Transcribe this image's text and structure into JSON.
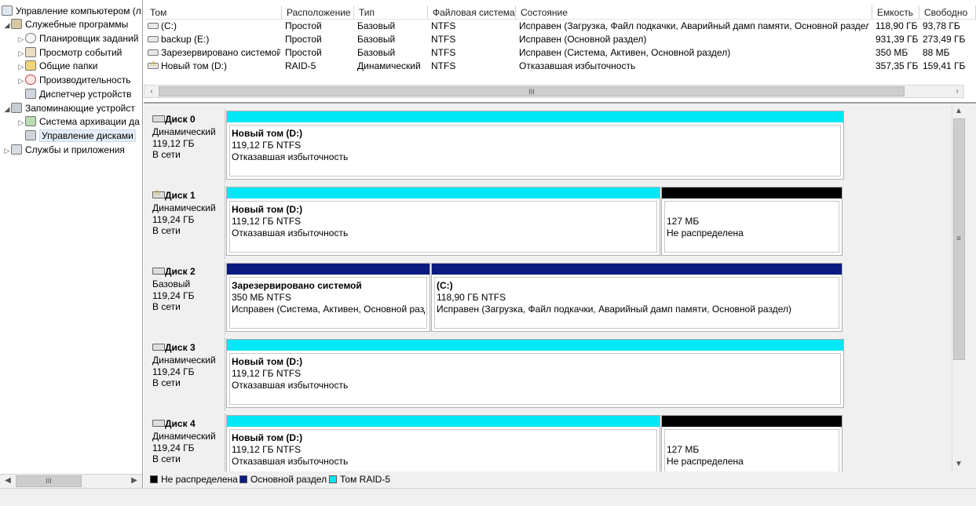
{
  "tree": {
    "root": "Управление компьютером (л",
    "items": [
      {
        "label": "Служебные программы",
        "icon": "tools-icon"
      },
      {
        "label": "Планировщик заданий",
        "icon": "clock-icon"
      },
      {
        "label": "Просмотр событий",
        "icon": "event-viewer-icon"
      },
      {
        "label": "Общие папки",
        "icon": "shared-folder-icon"
      },
      {
        "label": "Производительность",
        "icon": "performance-icon"
      },
      {
        "label": "Диспетчер устройств",
        "icon": "device-manager-icon"
      },
      {
        "label": "Запоминающие устройст",
        "icon": "storage-icon"
      },
      {
        "label": "Система архивации да",
        "icon": "backup-icon"
      },
      {
        "label": "Управление дисками",
        "icon": "disk-management-icon"
      },
      {
        "label": "Службы и приложения",
        "icon": "services-icon"
      }
    ]
  },
  "volume_list": {
    "columns": [
      "Том",
      "Расположение",
      "Тип",
      "Файловая система",
      "Состояние",
      "Емкость",
      "Свободно"
    ],
    "rows": [
      {
        "name": "(C:)",
        "layout": "Простой",
        "type": "Базовый",
        "fs": "NTFS",
        "status": "Исправен (Загрузка, Файл подкачки, Аварийный дамп памяти, Основной раздел)",
        "capacity": "118,90 ГБ",
        "free": "93,78 ГБ",
        "icon": "drive-icon"
      },
      {
        "name": "backup (E:)",
        "layout": "Простой",
        "type": "Базовый",
        "fs": "NTFS",
        "status": "Исправен (Основной раздел)",
        "capacity": "931,39 ГБ",
        "free": "273,49 ГБ",
        "icon": "drive-icon"
      },
      {
        "name": "Зарезервировано системой",
        "layout": "Простой",
        "type": "Базовый",
        "fs": "NTFS",
        "status": "Исправен (Система, Активен, Основной раздел)",
        "capacity": "350 МБ",
        "free": "88 МБ",
        "icon": "drive-icon"
      },
      {
        "name": "Новый том (D:)",
        "layout": "RAID-5",
        "type": "Динамический",
        "fs": "NTFS",
        "status": "Отказавшая избыточность",
        "capacity": "357,35 ГБ",
        "free": "159,41 ГБ",
        "icon": "drive-warning-icon"
      }
    ],
    "scroll_grip": "III"
  },
  "disks": [
    {
      "name": "Диск 0",
      "kind": "Динамический",
      "size": "119,12 ГБ",
      "state": "В сети",
      "warning": false,
      "parts": [
        {
          "title": "Новый том  (D:)",
          "size": "119,12 ГБ NTFS",
          "status": "Отказавшая избыточность",
          "bar": "#00e7f6"
        }
      ]
    },
    {
      "name": "Диск 1",
      "kind": "Динамический",
      "size": "119,24 ГБ",
      "state": "В сети",
      "warning": true,
      "parts": [
        {
          "title": "Новый том  (D:)",
          "size": "119,12 ГБ NTFS",
          "status": "Отказавшая избыточность",
          "bar": "#00e7f6"
        },
        {
          "title": "",
          "size": "127 МБ",
          "status": "Не распределена",
          "bar": "#000000"
        }
      ]
    },
    {
      "name": "Диск 2",
      "kind": "Базовый",
      "size": "119,24 ГБ",
      "state": "В сети",
      "warning": false,
      "parts": [
        {
          "title": "Зарезервировано системой",
          "size": "350 МБ NTFS",
          "status": "Исправен (Система, Активен, Основной разде",
          "bar": "#0b1a80"
        },
        {
          "title": "(C:)",
          "size": "118,90 ГБ NTFS",
          "status": "Исправен (Загрузка, Файл подкачки, Аварийный дамп памяти, Основной раздел)",
          "bar": "#0b1a80"
        }
      ]
    },
    {
      "name": "Диск 3",
      "kind": "Динамический",
      "size": "119,24 ГБ",
      "state": "В сети",
      "warning": false,
      "parts": [
        {
          "title": "Новый том  (D:)",
          "size": "119,12 ГБ NTFS",
          "status": "Отказавшая избыточность",
          "bar": "#00e7f6"
        }
      ]
    },
    {
      "name": "Диск 4",
      "kind": "Динамический",
      "size": "119,24 ГБ",
      "state": "В сети",
      "warning": false,
      "parts": [
        {
          "title": "Новый том  (D:)",
          "size": "119,12 ГБ NTFS",
          "status": "Отказавшая избыточность",
          "bar": "#00e7f6"
        },
        {
          "title": "",
          "size": "127 МБ",
          "status": "Не распределена",
          "bar": "#000000"
        }
      ]
    }
  ],
  "legend": [
    {
      "label": "Не распределена",
      "color": "#000000"
    },
    {
      "label": "Основной раздел",
      "color": "#0b1a80"
    },
    {
      "label": "Том RAID-5",
      "color": "#00e7f6"
    }
  ],
  "tree_scroll_grip": "III"
}
